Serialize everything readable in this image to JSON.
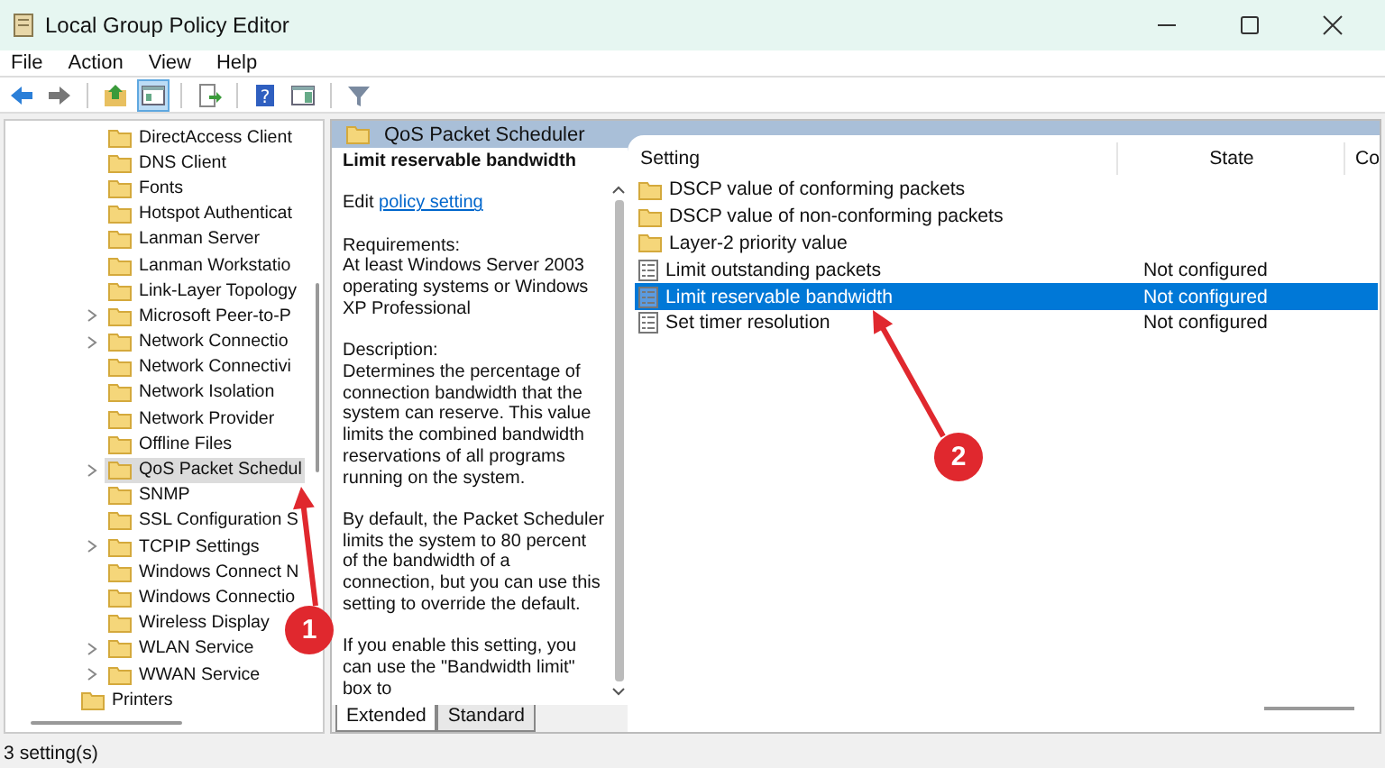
{
  "window": {
    "title": "Local Group Policy Editor"
  },
  "menu": [
    "File",
    "Action",
    "View",
    "Help"
  ],
  "toolbar": [
    {
      "buttons": [
        {
          "kind": "back",
          "selected": false
        },
        {
          "kind": "forward",
          "selected": false
        }
      ]
    },
    {
      "buttons": [
        {
          "kind": "up",
          "selected": false
        },
        {
          "kind": "tree",
          "selected": true
        }
      ]
    },
    {
      "buttons": [
        {
          "kind": "export",
          "selected": false
        }
      ]
    },
    {
      "buttons": [
        {
          "kind": "help",
          "glyph": "?",
          "selected": false
        },
        {
          "kind": "pane",
          "selected": false
        }
      ]
    },
    {
      "buttons": [
        {
          "kind": "filter",
          "selected": false
        }
      ]
    }
  ],
  "tree": {
    "nested_items": [
      {
        "label": "DirectAccess Client",
        "expandable": false,
        "selected": false
      },
      {
        "label": "DNS Client",
        "expandable": false,
        "selected": false
      },
      {
        "label": "Fonts",
        "expandable": false,
        "selected": false
      },
      {
        "label": "Hotspot Authenticat",
        "expandable": false,
        "selected": false
      },
      {
        "label": "Lanman Server",
        "expandable": false,
        "selected": false
      },
      {
        "label": "Lanman Workstatio",
        "expandable": false,
        "selected": false
      },
      {
        "label": "Link-Layer Topology",
        "expandable": false,
        "selected": false
      },
      {
        "label": "Microsoft Peer-to-P",
        "expandable": true,
        "selected": false
      },
      {
        "label": "Network Connectio",
        "expandable": true,
        "selected": false
      },
      {
        "label": "Network Connectivi",
        "expandable": false,
        "selected": false
      },
      {
        "label": "Network Isolation",
        "expandable": false,
        "selected": false
      },
      {
        "label": "Network Provider",
        "expandable": false,
        "selected": false
      },
      {
        "label": "Offline Files",
        "expandable": false,
        "selected": false
      },
      {
        "label": "QoS Packet Schedul",
        "expandable": true,
        "selected": true
      },
      {
        "label": "SNMP",
        "expandable": false,
        "selected": false
      },
      {
        "label": "SSL Configuration S",
        "expandable": false,
        "selected": false
      },
      {
        "label": "TCPIP Settings",
        "expandable": true,
        "selected": false
      },
      {
        "label": "Windows Connect N",
        "expandable": false,
        "selected": false
      },
      {
        "label": "Windows Connectio",
        "expandable": false,
        "selected": false
      },
      {
        "label": "Wireless Display",
        "expandable": false,
        "selected": false
      },
      {
        "label": "WLAN Service",
        "expandable": true,
        "selected": false
      },
      {
        "label": "WWAN Service",
        "expandable": true,
        "selected": false
      }
    ],
    "items": [
      {
        "label": "Printers",
        "expandable": false,
        "selected": false
      }
    ]
  },
  "pane": {
    "title": "QoS Packet Scheduler",
    "description": {
      "heading": "Limit reservable bandwidth",
      "edit_prefix": "Edit",
      "edit_link": "policy setting",
      "paragraphs": [
        "Requirements:\nAt least Windows Server 2003 operating systems or Windows XP Professional",
        "Description:\nDetermines the percentage of connection bandwidth that the system can reserve. This value limits the combined bandwidth reservations of all programs running on the system.",
        "By default, the Packet Scheduler limits the system to 80 percent of the bandwidth of a connection, but you can use this setting to override the default.",
        "If you enable this setting, you can use the \"Bandwidth limit\" box to"
      ]
    },
    "columns": [
      "Setting",
      "State",
      "Co"
    ],
    "rows": [
      {
        "kind": "folder",
        "name": "DSCP value of conforming packets",
        "selected": false
      },
      {
        "kind": "folder",
        "name": "DSCP value of non-conforming packets",
        "selected": false
      },
      {
        "kind": "folder",
        "name": "Layer-2 priority value",
        "selected": false
      },
      {
        "kind": "setting",
        "name": "Limit outstanding packets",
        "state": "Not configured",
        "selected": false
      },
      {
        "kind": "setting",
        "name": "Limit reservable bandwidth",
        "state": "Not configured",
        "selected": true
      },
      {
        "kind": "setting",
        "name": "Set timer resolution",
        "state": "Not configured",
        "selected": false
      }
    ],
    "tabs": [
      {
        "label": "Extended",
        "selected": true
      },
      {
        "label": "Standard",
        "selected": false
      }
    ]
  },
  "status_bar": "3 setting(s)",
  "annotations": [
    {
      "number": "1"
    },
    {
      "number": "2"
    }
  ]
}
